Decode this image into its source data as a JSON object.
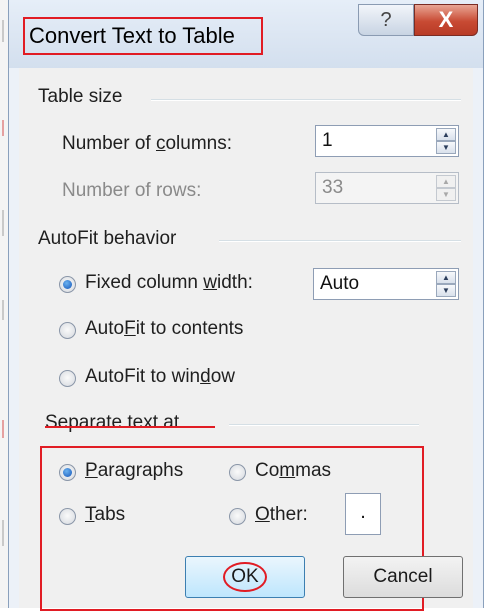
{
  "window": {
    "title": "Convert Text to Table",
    "help_glyph": "?",
    "close_glyph": "X"
  },
  "table_size": {
    "label": "Table size",
    "columns_label_pre": "Number of ",
    "columns_label_ul": "c",
    "columns_label_post": "olumns:",
    "columns_value": "1",
    "rows_label": "Number of rows:",
    "rows_value": "33"
  },
  "autofit": {
    "label": "AutoFit behavior",
    "fixed_pre": "Fixed column ",
    "fixed_ul": "w",
    "fixed_post": "idth:",
    "fixed_value": "Auto",
    "contents_pre": "Auto",
    "contents_ul": "F",
    "contents_post": "it to contents",
    "window_pre": "AutoFit to win",
    "window_ul": "d",
    "window_post": "ow",
    "selected": "fixed"
  },
  "separate": {
    "label": "Separate text at",
    "paragraphs_ul": "P",
    "paragraphs_post": "aragraphs",
    "commas_pre": "Co",
    "commas_ul": "m",
    "commas_post": "mas",
    "tabs_ul": "T",
    "tabs_post": "abs",
    "other_ul": "O",
    "other_post": "ther:",
    "other_value": ".",
    "selected": "paragraphs"
  },
  "buttons": {
    "ok": "OK",
    "cancel": "Cancel"
  },
  "icons": {
    "spin_up": "up-arrow-icon",
    "spin_down": "down-arrow-icon"
  },
  "colors": {
    "highlight_red": "#e11c24",
    "radio_selected": "#1655b8",
    "close_red": "#c84a33"
  }
}
